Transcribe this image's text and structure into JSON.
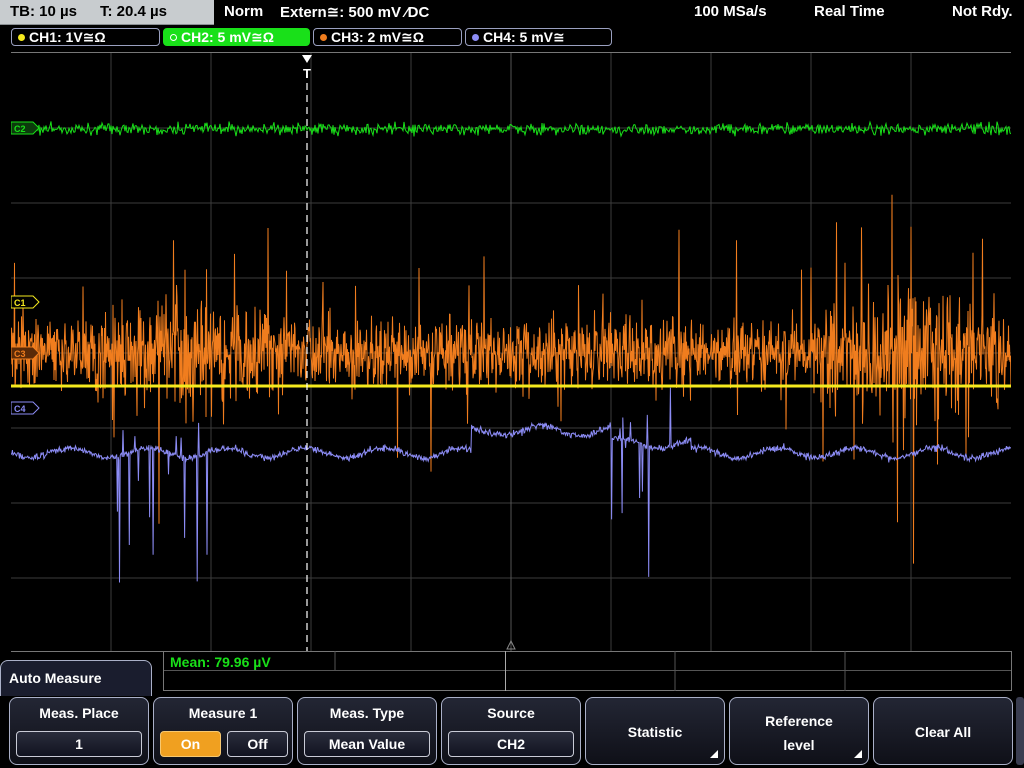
{
  "status": {
    "timebase": "TB: 10 µs",
    "trigger_time": "T: 20.4 µs",
    "trigger_mode": "Norm",
    "trigger_source": "Extern≅: 500 mV ⁄DC",
    "sample_rate": "100 MSa/s",
    "acq_mode": "Real Time",
    "trigger_status": "Not Rdy."
  },
  "channels": [
    {
      "label": "CH1: 1V≅Ω",
      "color": "#f5ea1e",
      "active": false
    },
    {
      "label": "CH2: 5 mV≅Ω",
      "color": "#19e019",
      "active": true
    },
    {
      "label": "CH3: 2 mV≅Ω",
      "color": "#f07d1e",
      "active": false
    },
    {
      "label": "CH4: 5 mV≅",
      "color": "#8c8cf5",
      "active": false
    }
  ],
  "markers": {
    "ch1": "C1",
    "ch2": "C2",
    "ch3": "C3",
    "ch4": "C4",
    "trigger": "T"
  },
  "measurement": {
    "readout": "Mean: 79.96 µV"
  },
  "menu": {
    "title": "Auto Measure",
    "meas_place": {
      "label": "Meas. Place",
      "value": "1"
    },
    "measure1": {
      "label": "Measure 1",
      "on": "On",
      "off": "Off",
      "state": "on"
    },
    "meas_type": {
      "label": "Meas. Type",
      "value": "Mean Value"
    },
    "source": {
      "label": "Source",
      "value": "CH2"
    },
    "statistic": {
      "label": "Statistic"
    },
    "reference_level": {
      "label_line1": "Reference",
      "label_line2": "level"
    },
    "clear_all": {
      "label": "Clear All"
    }
  },
  "colors": {
    "ch1": "#f5ea1e",
    "ch2": "#19e019",
    "ch3": "#f07d1e",
    "ch4": "#8c8cf5",
    "grid": "#3c3c3c",
    "active_toggle": "#f0a020"
  }
}
